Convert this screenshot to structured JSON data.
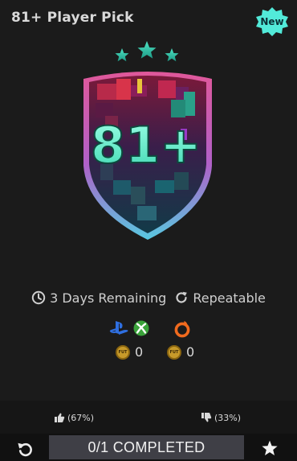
{
  "card": {
    "title": "81+ Player Pick",
    "badge": "New",
    "shield_text": "81+",
    "rating_stars": 3
  },
  "meta": {
    "time_icon": "clock-icon",
    "time_label": "3 Days Remaining",
    "repeat_icon": "repeat-icon",
    "repeat_label": "Repeatable"
  },
  "platforms": {
    "group1": [
      "playstation-icon",
      "xbox-icon"
    ],
    "group2": [
      "origin-icon"
    ]
  },
  "rewards": [
    {
      "icon": "fut-coin-icon",
      "coin_text": "FUT",
      "value": "0"
    },
    {
      "icon": "fut-coin-icon",
      "coin_text": "FUT",
      "value": "0"
    }
  ],
  "votes": {
    "up": "(67%)",
    "down": "(33%)"
  },
  "actions": {
    "progress": "0/1 COMPLETED"
  },
  "colors": {
    "accent": "#3fe0c0",
    "badge": "#4fe8d8",
    "shield_outer_top": "#e0589a",
    "shield_outer_bottom": "#58c8e0"
  }
}
